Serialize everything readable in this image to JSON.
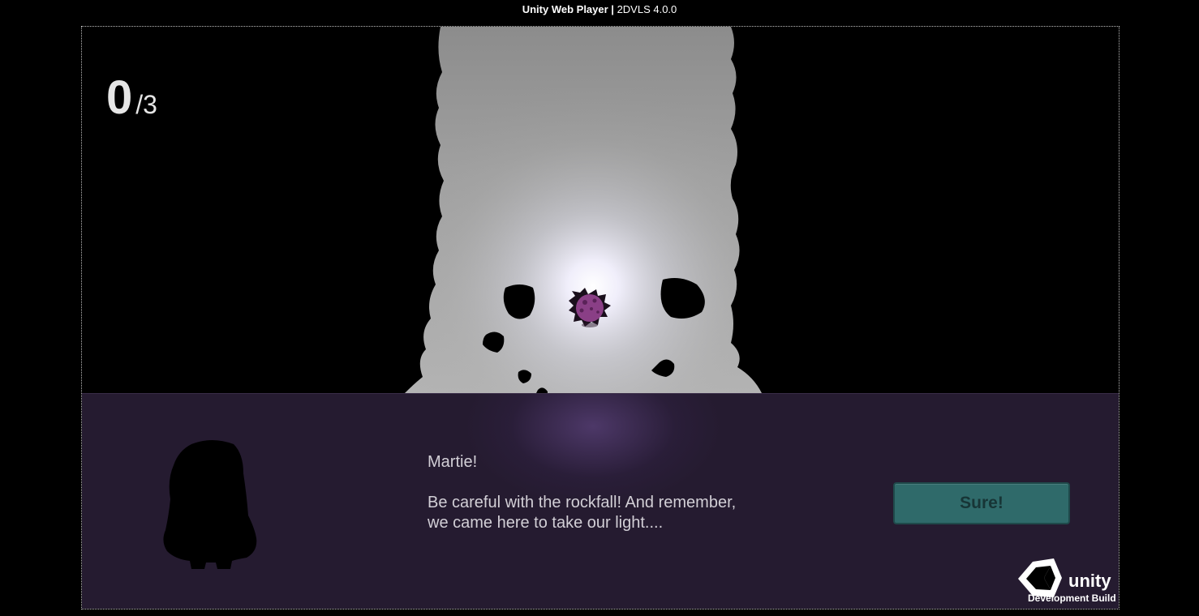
{
  "window": {
    "title_bold": "Unity Web Player |",
    "title_rest": "2DVLS 4.0.0"
  },
  "hud": {
    "collected": "0",
    "total": "/3"
  },
  "dialog": {
    "speaker": "Martie!",
    "lines": [
      "Be careful with the rockfall!  And remember,",
      "we came here to take our light...."
    ],
    "reply_button": "Sure!"
  },
  "badge": {
    "wordmark": "unity",
    "build": "Development Build"
  },
  "icons": {
    "player": "purple-creature-icon",
    "rock": "rock-icon",
    "portrait": "character-silhouette-icon",
    "unity_logo": "unity-cube-icon"
  },
  "colors": {
    "dialog_bg": "#251b30",
    "button_bg": "#2f6a6a",
    "button_text": "#173536",
    "fog": "#9a9a9a",
    "player": "#8a3f86"
  }
}
